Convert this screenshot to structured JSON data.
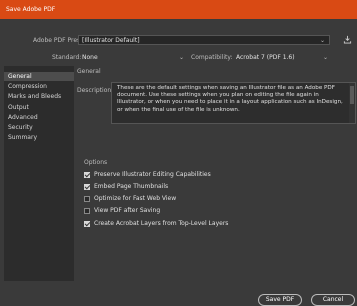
{
  "window": {
    "title": "Save Adobe PDF"
  },
  "preset": {
    "label": "Adobe PDF Preset:",
    "value": "[Illustrator Default]"
  },
  "standard": {
    "label": "Standard:",
    "value": "None"
  },
  "compatibility": {
    "label": "Compatibility:",
    "value": "Acrobat 7 (PDF 1.6)"
  },
  "sidebar": {
    "items": [
      {
        "label": "General"
      },
      {
        "label": "Compression"
      },
      {
        "label": "Marks and Bleeds"
      },
      {
        "label": "Output"
      },
      {
        "label": "Advanced"
      },
      {
        "label": "Security"
      },
      {
        "label": "Summary"
      }
    ]
  },
  "general": {
    "heading": "General",
    "description_label": "Description:",
    "description": "These are the default settings when saving an Illustrator file as an Adobe PDF document. Use these settings when you plan on editing the file again in Illustrator, or when you need to place it in a layout application such as InDesign, or when the final use of the file is unknown.",
    "options_label": "Options",
    "options": [
      {
        "label": "Preserve Illustrator Editing Capabilities",
        "checked": true
      },
      {
        "label": "Embed Page Thumbnails",
        "checked": true
      },
      {
        "label": "Optimize for Fast Web View",
        "checked": false
      },
      {
        "label": "View PDF after Saving",
        "checked": false
      },
      {
        "label": "Create Acrobat Layers from Top-Level Layers",
        "checked": true
      }
    ]
  },
  "buttons": {
    "save": "Save PDF",
    "cancel": "Cancel"
  },
  "colors": {
    "titlebar": "#d94a14",
    "background": "#3a3a3a"
  }
}
